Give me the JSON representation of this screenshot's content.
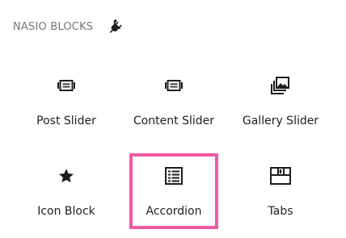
{
  "inserter": {
    "category_title": "NASIO BLOCKS",
    "category_icon": "plug-icon",
    "blocks": [
      {
        "label": "Post Slider",
        "icon": "slider-icon"
      },
      {
        "label": "Content Slider",
        "icon": "slider-icon"
      },
      {
        "label": "Gallery Slider",
        "icon": "gallery-icon"
      },
      {
        "label": "Icon Block",
        "icon": "star-icon"
      },
      {
        "label": "Accordion",
        "icon": "list-icon",
        "highlighted": true,
        "highlight_color": "#f05aa5"
      },
      {
        "label": "Tabs",
        "icon": "tabs-icon"
      }
    ]
  }
}
